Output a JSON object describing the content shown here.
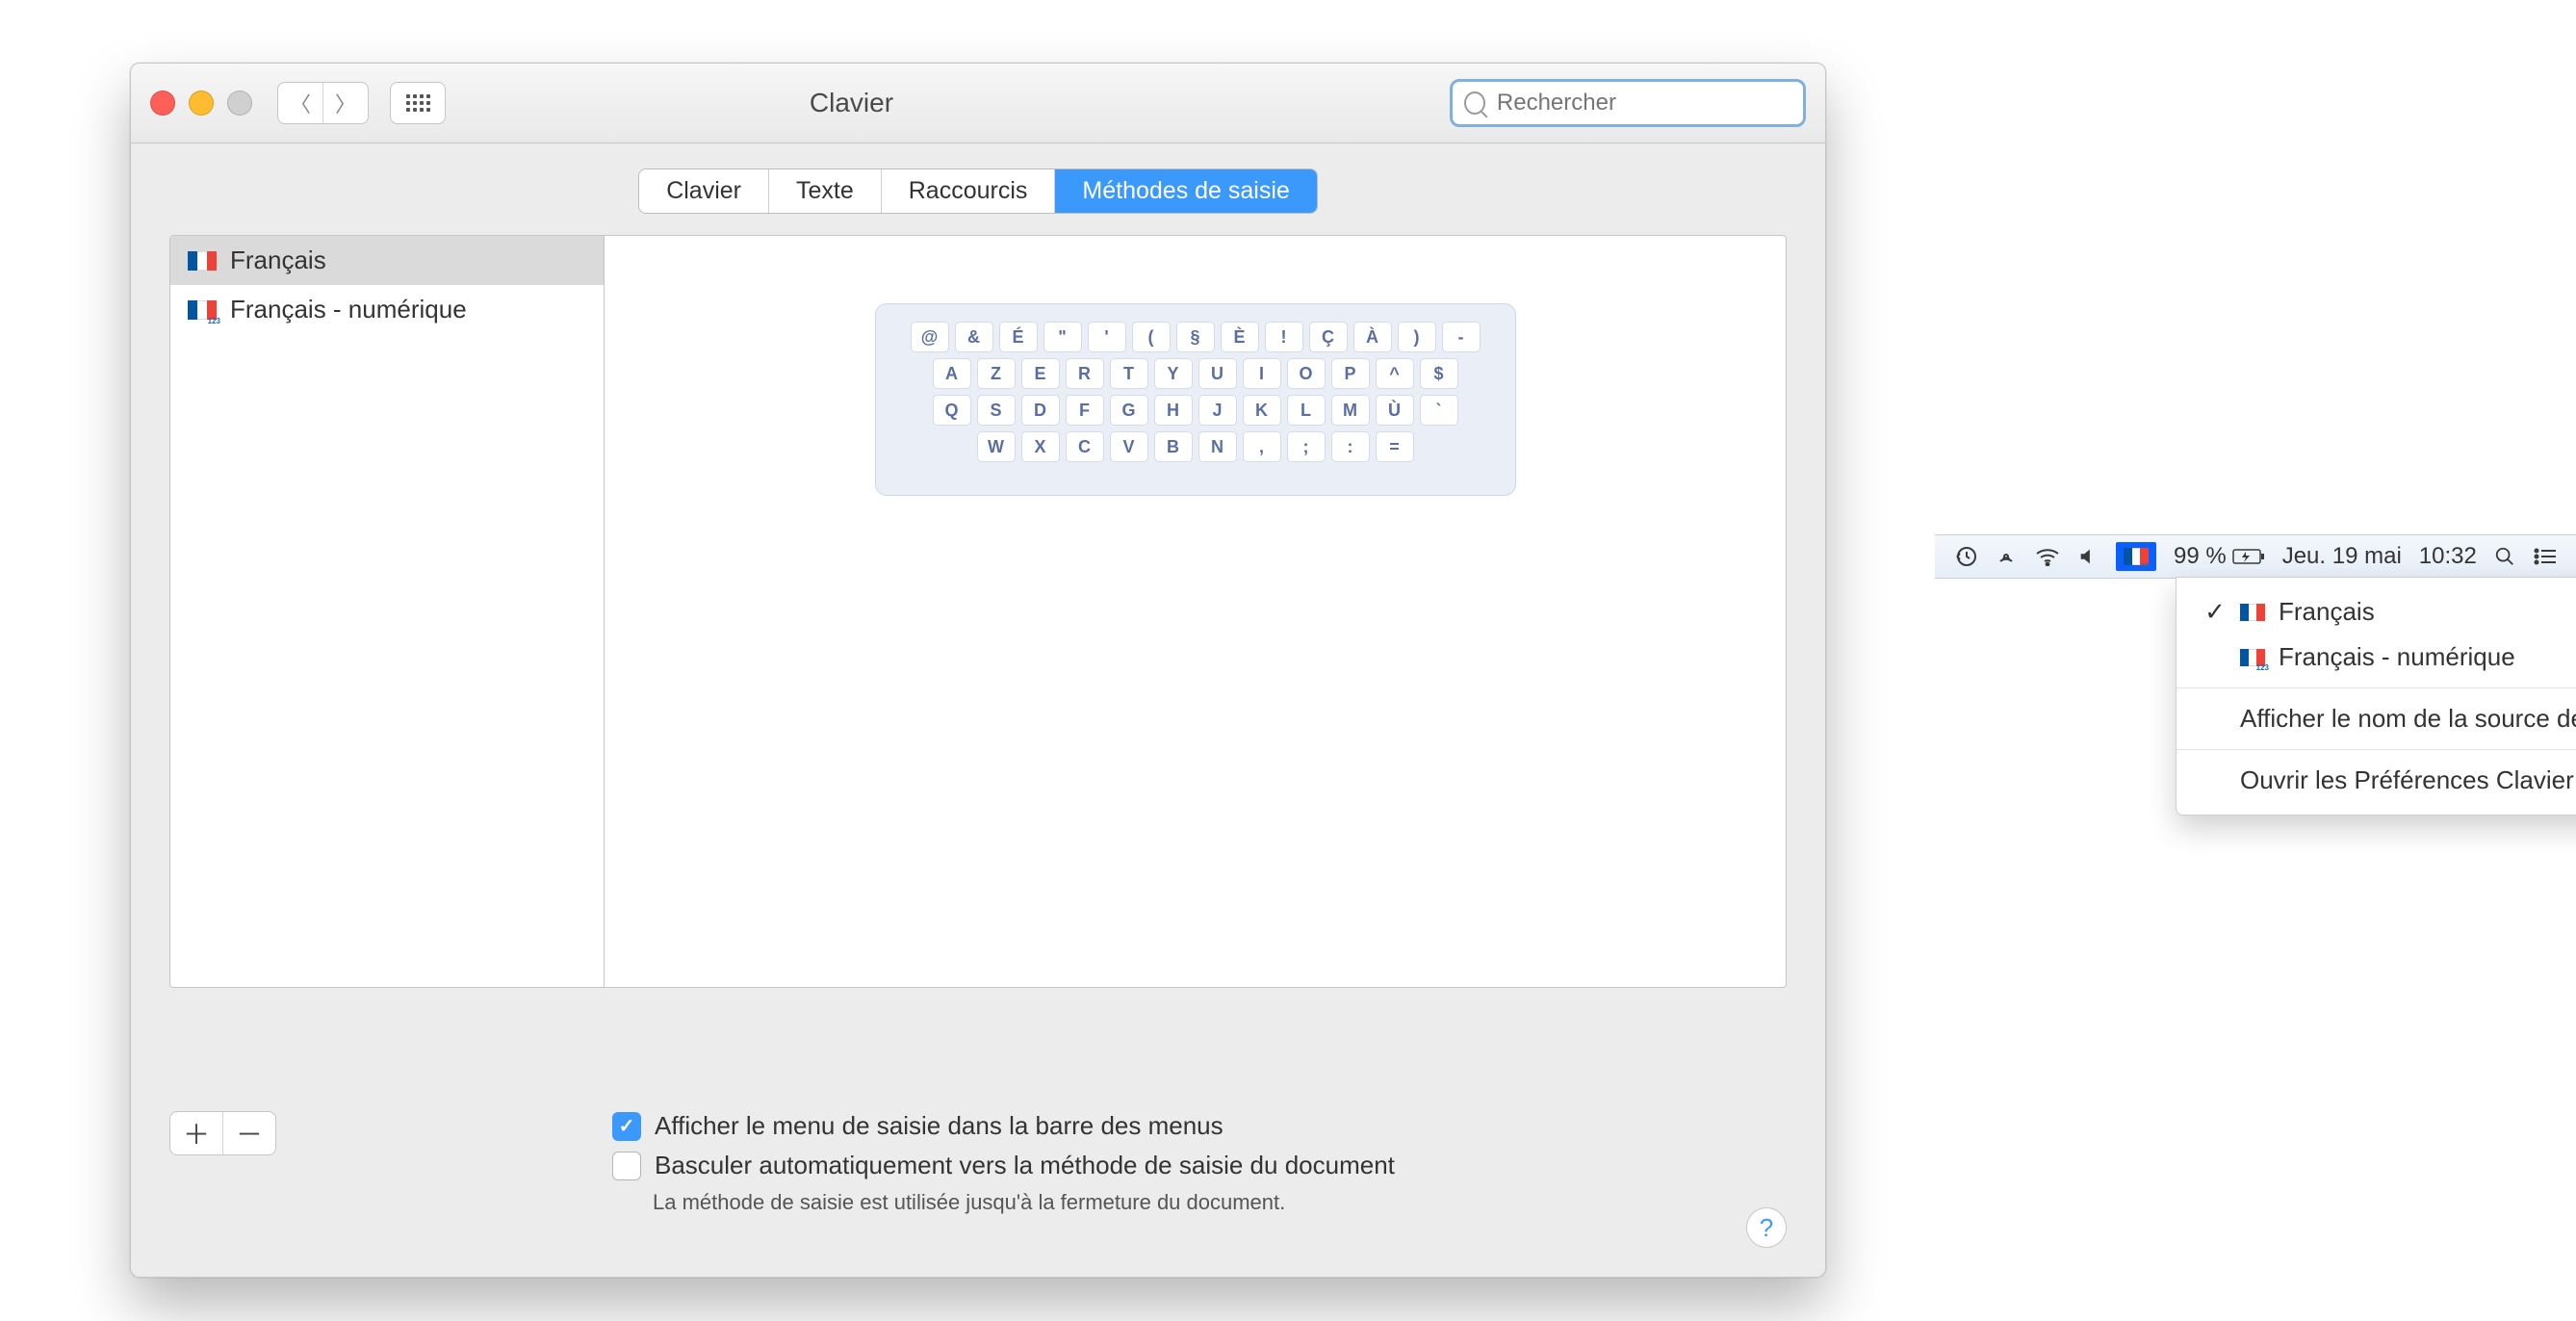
{
  "window": {
    "title": "Clavier",
    "search_placeholder": "Rechercher",
    "tabs": [
      "Clavier",
      "Texte",
      "Raccourcis",
      "Méthodes de saisie"
    ],
    "active_tab_index": 3,
    "input_sources": [
      {
        "label": "Français",
        "selected": true,
        "numeric": false
      },
      {
        "label": "Français - numérique",
        "selected": false,
        "numeric": true
      }
    ],
    "keyboard_rows": [
      [
        "@",
        "&",
        "É",
        "\"",
        "'",
        "(",
        "§",
        "È",
        "!",
        "Ç",
        "À",
        ")",
        "-"
      ],
      [
        "A",
        "Z",
        "E",
        "R",
        "T",
        "Y",
        "U",
        "I",
        "O",
        "P",
        "^",
        "$"
      ],
      [
        "Q",
        "S",
        "D",
        "F",
        "G",
        "H",
        "J",
        "K",
        "L",
        "M",
        "Ù",
        "`"
      ],
      [
        "W",
        "X",
        "C",
        "V",
        "B",
        "N",
        ",",
        ";",
        ":",
        "="
      ]
    ],
    "checkbox1": {
      "checked": true,
      "label": "Afficher le menu de saisie dans la barre des menus"
    },
    "checkbox2": {
      "checked": false,
      "label": "Basculer automatiquement vers la méthode de saisie du document"
    },
    "checkbox2_note": "La méthode de saisie est utilisée jusqu'à la fermeture du document."
  },
  "menubar": {
    "battery_pct": "99 %",
    "date": "Jeu. 19 mai",
    "time": "10:32",
    "dropdown": {
      "items": [
        {
          "checked": true,
          "label": "Français",
          "numeric": false
        },
        {
          "checked": false,
          "label": "Français - numérique",
          "numeric": true
        }
      ],
      "show_name": "Afficher le nom de la source de saisie",
      "open_prefs": "Ouvrir les Préférences Clavier…"
    }
  }
}
